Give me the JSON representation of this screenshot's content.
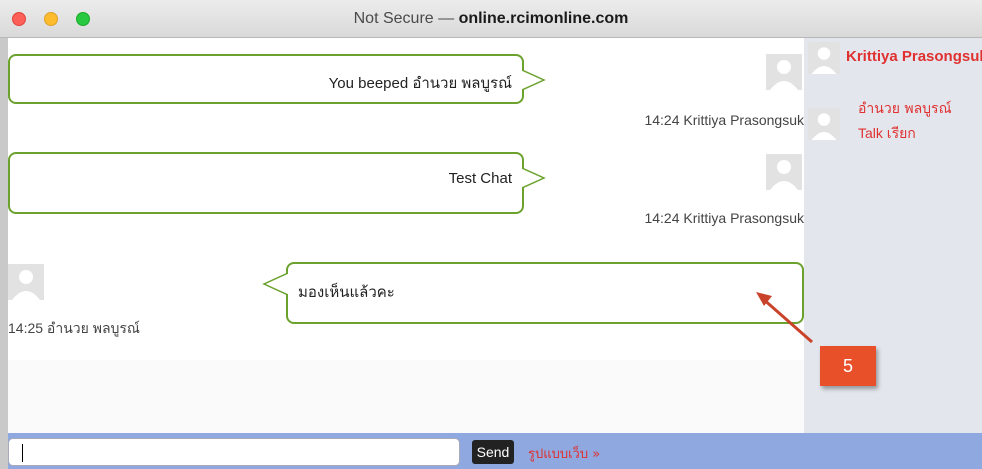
{
  "window": {
    "title_prefix": "Not Secure — ",
    "title_domain": "online.rcimonline.com"
  },
  "messages": [
    {
      "text": "You beeped อำนวย พลบูรณ์",
      "meta": "14:24 Krittiya Prasongsuk"
    },
    {
      "text": "Test Chat",
      "meta": "14:24 Krittiya Prasongsuk"
    },
    {
      "text": "มองเห็นแล้วคะ",
      "meta": "14:25 อำนวย พลบูรณ์"
    }
  ],
  "sidebar": {
    "self_name": "Krittiya Prasongsuk",
    "users": [
      {
        "name": "อำนวย พลบูรณ์",
        "status": "Talk เรียก"
      }
    ]
  },
  "composer": {
    "input_value": "",
    "send_label": "Send",
    "web_link": "รูปแบบเว็บ »"
  },
  "annotation": {
    "badge": "5",
    "color": "#e8502a"
  },
  "colors": {
    "bubble_border": "#6ba22e",
    "accent_red": "#e03030",
    "sidebar_bg": "#e3e7ed",
    "bottombar_bg": "#8fa8e0"
  }
}
